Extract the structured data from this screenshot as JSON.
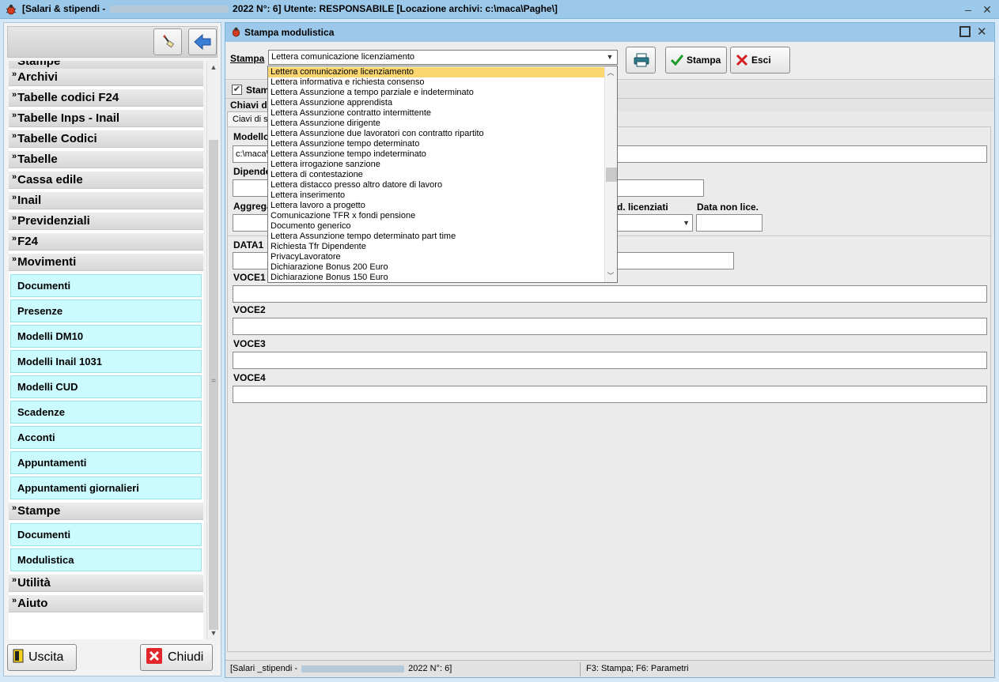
{
  "app": {
    "title_prefix": "[Salari & stipendi - ",
    "title_suffix": " 2022 N°: 6]  Utente: RESPONSABILE  [Locazione archivi: c:\\maca\\Paghe\\]"
  },
  "sidebar": {
    "groups": [
      {
        "label": "Archivi"
      },
      {
        "label": "Tabelle codici F24"
      },
      {
        "label": "Tabelle Inps - Inail"
      },
      {
        "label": "Tabelle Codici"
      },
      {
        "label": "Tabelle"
      },
      {
        "label": "Cassa edile"
      },
      {
        "label": "Inail"
      },
      {
        "label": "Previdenziali"
      },
      {
        "label": "F24"
      },
      {
        "label": "Movimenti"
      },
      {
        "label": "Stampe"
      },
      {
        "label": "Utilità"
      },
      {
        "label": "Aiuto"
      }
    ],
    "movimenti_items": [
      {
        "label": "Documenti"
      },
      {
        "label": "Presenze"
      },
      {
        "label": "Modelli DM10"
      },
      {
        "label": "Modelli Inail 1031"
      },
      {
        "label": "Modelli CUD"
      },
      {
        "label": "Scadenze"
      },
      {
        "label": "Acconti"
      },
      {
        "label": "Appuntamenti"
      },
      {
        "label": "Appuntamenti giornalieri"
      }
    ],
    "stampe_items": [
      {
        "label": "Documenti"
      },
      {
        "label": "Modulistica"
      }
    ],
    "buttons": {
      "uscita": "Uscita",
      "chiudi": "Chiudi"
    }
  },
  "window": {
    "title": "Stampa modulistica",
    "stampa_label": "Stampa",
    "stampa_value": "Lettera comunicazione licenziamento",
    "print_button": "Stampa",
    "exit_button": "Esci",
    "checkbox_label": "Stam",
    "keys_label": "Chiavi d",
    "tab_label": "Ciavi di se",
    "fields": {
      "modello_label": "Modello",
      "modello_value": "c:\\maca\\",
      "dipendente_label": "Dipende",
      "aggregazione_label": "Aggrega",
      "licenziati_label": "d. licenziati",
      "data_non_lic_label": "Data non lice.",
      "data1_label": "DATA1",
      "voce1_label": "VOCE1",
      "voce2_label": "VOCE2",
      "voce3_label": "VOCE3",
      "voce4_label": "VOCE4"
    },
    "status": {
      "left_prefix": "[Salari _stipendi - ",
      "left_suffix": " 2022 N°: 6]",
      "right": "F3: Stampa; F6: Parametri"
    }
  },
  "dropdown": {
    "selected_index": 0,
    "items": [
      "Lettera comunicazione licenziamento",
      "Lettera informativa e richiesta consenso",
      "Lettera Assunzione a tempo parziale e indeterminato",
      "Lettera Assunzione apprendista",
      "Lettera Assunzione contratto intermittente",
      "Lettera Assunzione dirigente",
      "Lettera Assunzione due lavoratori con contratto ripartito",
      "Lettera Assunzione tempo determinato",
      "Lettera Assunzione tempo indeterminato",
      "Lettera irrogazione sanzione",
      "Lettera di contestazione",
      "Lettera distacco presso altro datore di lavoro",
      "Lettera inserimento",
      "Lettera lavoro a progetto",
      "Comunicazione TFR x fondi pensione",
      "Documento generico",
      "Lettera Assunzione tempo determinato part time",
      "Richiesta Tfr Dipendente",
      "PrivacyLavoratore",
      "Dichiarazione Bonus 200 Euro",
      "Dichiarazione Bonus 150 Euro"
    ]
  },
  "colors": {
    "titlebar": "#9cc9ea",
    "submenu": "#ccfbff",
    "selection": "#fcd66f"
  }
}
